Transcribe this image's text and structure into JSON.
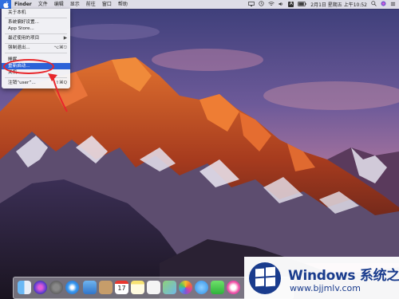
{
  "menubar": {
    "app_name": "Finder",
    "menus": [
      "文件",
      "编辑",
      "显示",
      "前往",
      "窗口",
      "帮助"
    ],
    "status": {
      "input_method": "A",
      "date_time": "2月1日 星期五 上午10:52"
    }
  },
  "apple_menu": {
    "items": [
      {
        "label": "关于本机"
      },
      {
        "label": "系统偏好设置..."
      },
      {
        "label": "App Store..."
      },
      {
        "label": "最近使用的项目"
      },
      {
        "label": "强制退出...",
        "shortcut": "⌥⌘⎋"
      },
      {
        "label": "睡眠"
      },
      {
        "label": "重新启动..."
      },
      {
        "label": "关机..."
      },
      {
        "label": "注销“user”...",
        "shortcut": "⇧⌘Q"
      }
    ]
  },
  "dock": {
    "items": [
      "finder-icon",
      "siri-icon",
      "launchpad-icon",
      "safari-icon",
      "mail-icon",
      "contacts-icon",
      "calendar-icon",
      "notes-icon",
      "reminders-icon",
      "maps-icon",
      "photos-icon",
      "messages-icon",
      "facetime-icon",
      "itunes-icon"
    ],
    "calendar_day": "17"
  },
  "watermark": {
    "brand": "Windows",
    "brand_cn": "系统之家",
    "url": "www.bjjmlv.com"
  },
  "colors": {
    "menu_highlight": "#2c62d8",
    "annotation": "#e8262b",
    "watermark_text": "#1a3c8d"
  }
}
